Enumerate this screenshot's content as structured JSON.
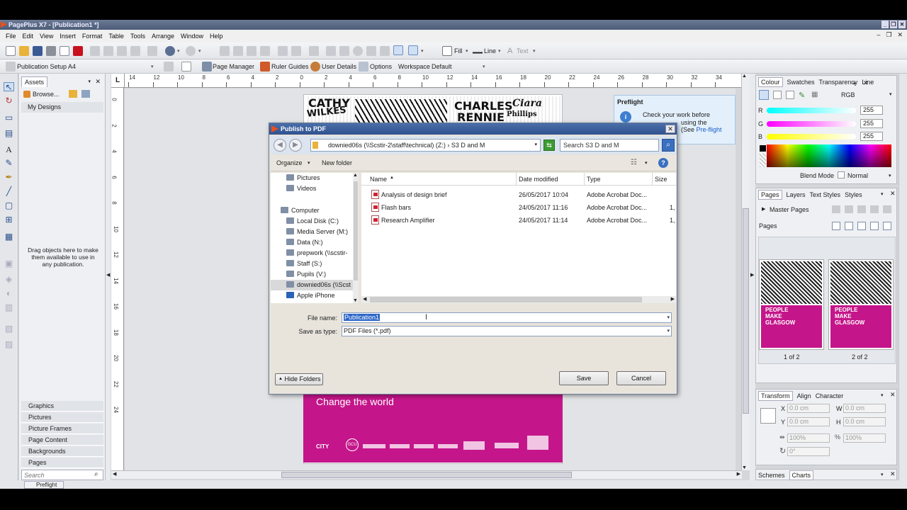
{
  "app": {
    "title": "PagePlus X7 - [Publication1 *]"
  },
  "menu": [
    "File",
    "Edit",
    "View",
    "Insert",
    "Format",
    "Table",
    "Tools",
    "Arrange",
    "Window",
    "Help"
  ],
  "toolbar": {
    "fill_label": "Fill",
    "line_label": "Line",
    "text_label": "Text",
    "pub_setup_label": "Publication Setup",
    "page_size": "A4",
    "page_manager_label": "Page Manager",
    "ruler_guides_label": "Ruler Guides",
    "user_details_label": "User Details",
    "options_label": "Options",
    "workspace_label": "Workspace",
    "workspace_value": "Default"
  },
  "assets": {
    "tab_label": "Assets",
    "browse_label": "Browse...",
    "my_designs_label": "My Designs",
    "hint": "Drag objects here to make them available to use in any publication.",
    "categories": [
      "Graphics",
      "Pictures",
      "Picture Frames",
      "Page Content",
      "Backgrounds",
      "Pages"
    ],
    "search_placeholder": "Search"
  },
  "ruler": {
    "corner": "L",
    "top_ticks": [
      "14",
      "12",
      "10",
      "8",
      "6",
      "4",
      "2",
      "0",
      "2",
      "4",
      "6",
      "8",
      "10",
      "12",
      "14",
      "16",
      "18",
      "20",
      "22",
      "24",
      "26",
      "28",
      "30",
      "32",
      "34"
    ],
    "left_ticks": [
      "0",
      "2",
      "4",
      "6",
      "8",
      "10",
      "12",
      "14",
      "16",
      "18",
      "20",
      "22",
      "24"
    ]
  },
  "canvas": {
    "top_names": [
      "CATHY",
      "WILKES",
      "CHARLES",
      "RENNIE",
      "Ciara",
      "Phillips"
    ],
    "slogan": "Change the world",
    "logos": [
      "CITY",
      "GCU",
      "",
      "",
      "",
      "",
      "",
      "",
      "",
      ""
    ]
  },
  "preflight": {
    "title": "Preflight",
    "text": "Check your work before",
    "text2": "using the",
    "text3": "(See",
    "link": "Pre-flight"
  },
  "colour": {
    "tabs": [
      "Colour",
      "Swatches",
      "Transparency",
      "Line"
    ],
    "model": "RGB",
    "r_label": "R",
    "g_label": "G",
    "b_label": "B",
    "r": "255",
    "g": "255",
    "b": "255",
    "blend_mode_label": "Blend Mode",
    "blend_mode_value": "Normal"
  },
  "pages_panel": {
    "tabs": [
      "Pages",
      "Layers",
      "Text Styles",
      "Styles"
    ],
    "master_pages_label": "Master Pages",
    "pages_label": "Pages",
    "thumbs": [
      {
        "label": "1 of 2",
        "text": "PEOPLE MAKE GLASGOW"
      },
      {
        "label": "2 of 2",
        "text": "PEOPLE MAKE GLASGOW"
      }
    ]
  },
  "transform": {
    "tabs": [
      "Transform",
      "Align",
      "Character"
    ],
    "x_label": "X",
    "y_label": "Y",
    "w_label": "W",
    "h_label": "H",
    "x": "0.0 cm",
    "y": "0.0 cm",
    "w": "0.0 cm",
    "h": "0.0 cm",
    "scale_x": "100%",
    "scale_y": "100%",
    "rotate": "0°"
  },
  "bottom_tabs": [
    "Schemes",
    "Charts"
  ],
  "status": {
    "preflight_label": "Preflight"
  },
  "dialog": {
    "title": "Publish to PDF",
    "address": "downied06s (\\\\Scstir-2\\staff\\technical) (Z:)  ›  S3 D and M",
    "search_placeholder": "Search S3 D and M",
    "organize_label": "Organize",
    "new_folder_label": "New folder",
    "nav_items": [
      {
        "label": "Pictures",
        "indent": 1
      },
      {
        "label": "Videos",
        "indent": 1
      },
      {
        "label": "",
        "indent": 0
      },
      {
        "label": "Computer",
        "indent": 0
      },
      {
        "label": "Local Disk (C:)",
        "indent": 1
      },
      {
        "label": "Media Server (M:)",
        "indent": 1
      },
      {
        "label": "Data (N:)",
        "indent": 1
      },
      {
        "label": "prepwork (\\\\scstir-",
        "indent": 1
      },
      {
        "label": "Staff (S:)",
        "indent": 1
      },
      {
        "label": "Pupils (V:)",
        "indent": 1
      },
      {
        "label": "downied06s (\\\\Scst",
        "indent": 1
      },
      {
        "label": "Apple iPhone",
        "indent": 1
      }
    ],
    "columns": [
      "Name",
      "Date modified",
      "Type",
      "Size"
    ],
    "files": [
      {
        "name": "Analysis of design brief",
        "date": "26/05/2017 10:04",
        "type": "Adobe Acrobat Doc...",
        "size": ""
      },
      {
        "name": "Flash bars",
        "date": "24/05/2017 11:16",
        "type": "Adobe Acrobat Doc...",
        "size": "1,"
      },
      {
        "name": "Research Amplifier",
        "date": "24/05/2017 11:14",
        "type": "Adobe Acrobat Doc...",
        "size": "1,"
      }
    ],
    "file_name_label": "File name:",
    "file_name_value": "Publication1",
    "save_type_label": "Save as type:",
    "save_type_value": "PDF Files (*.pdf)",
    "hide_folders_label": "Hide Folders",
    "save_label": "Save",
    "cancel_label": "Cancel"
  }
}
